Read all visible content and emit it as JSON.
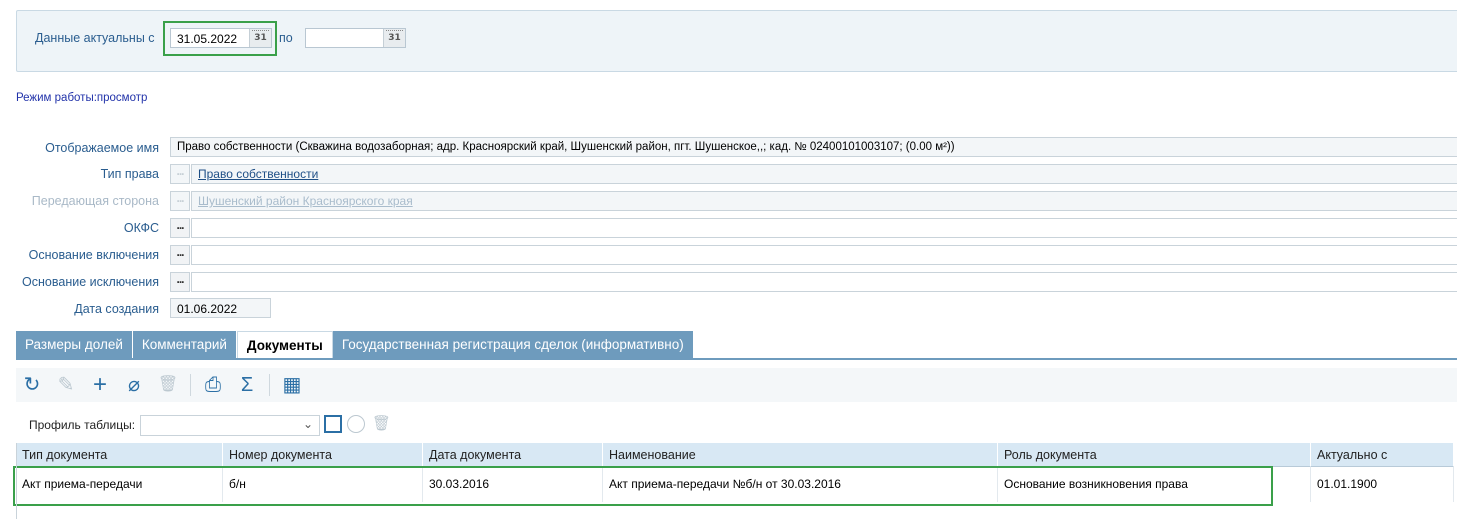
{
  "filter": {
    "actual_label": "Данные актуальны с",
    "date_from": "31.05.2022",
    "to_label": "по",
    "date_to": "",
    "calendar_glyph": "31"
  },
  "mode_text": "Режим работы:просмотр",
  "form": {
    "display_name_label": "Отображаемое имя",
    "display_name_value": "Право собственности (Скважина водозаборная; адр. Красноярский край, Шушенский район, пгт. Шушенское,,; кад. № 02400101003107; (0.00 м²))",
    "right_type_label": "Тип права",
    "right_type_value": "Право собственности",
    "transferring_label": "Передающая сторона",
    "transferring_value": "Шушенский район Красноярского края",
    "okfs_label": "ОКФС",
    "okfs_value": "",
    "incl_basis_label": "Основание включения",
    "incl_basis_value": "",
    "excl_basis_label": "Основание исключения",
    "excl_basis_value": "",
    "created_label": "Дата создания",
    "created_value": "01.06.2022",
    "picker_glyph": "..."
  },
  "tabs": [
    {
      "label": "Размеры долей"
    },
    {
      "label": "Комментарий"
    },
    {
      "label": "Документы"
    },
    {
      "label": "Государственная регистрация сделок (информативно)"
    }
  ],
  "toolbar": {
    "icons": [
      "refresh-icon",
      "edit-icon",
      "add-icon",
      "attach-icon",
      "delete-icon",
      "print-icon",
      "sum-icon",
      "table-settings-icon"
    ],
    "glyphs": {
      "refresh": "↻",
      "edit": "✎",
      "add": "+",
      "attach": "⌀",
      "delete": "🗑",
      "print": "⎙",
      "sum": "Σ",
      "table": "▦"
    }
  },
  "profile": {
    "label": "Профиль таблицы:",
    "value": ""
  },
  "grid": {
    "columns": [
      "Тип документа",
      "Номер документа",
      "Дата документа",
      "Наименование",
      "Роль документа",
      "Актуально с"
    ],
    "rows": [
      [
        "Акт приема-передачи",
        "б/н",
        "30.03.2016",
        "Акт приема-передачи №б/н от 30.03.2016",
        "Основание возникновения права",
        "01.01.1900"
      ]
    ]
  },
  "colors": {
    "accent": "#6e9bbd",
    "highlight": "#3aa04a",
    "label": "#2a5d8f"
  }
}
